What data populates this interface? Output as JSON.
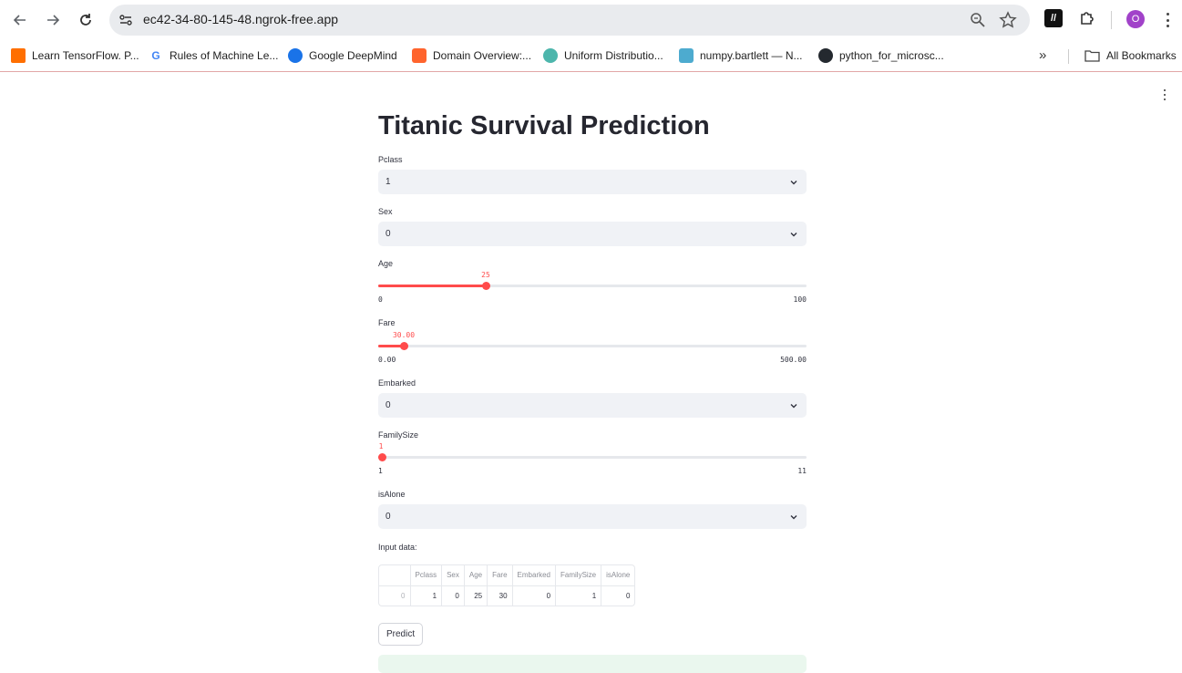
{
  "browser": {
    "url": "ec42-34-80-145-48.ngrok-free.app",
    "profile_initial": "O",
    "bookmarks": [
      {
        "label": "Learn TensorFlow. P...",
        "icon": "tensorflow-icon"
      },
      {
        "label": "Rules of Machine Le...",
        "icon": "google-icon"
      },
      {
        "label": "Google DeepMind",
        "icon": "deepmind-icon"
      },
      {
        "label": "Domain Overview:...",
        "icon": "semrush-icon"
      },
      {
        "label": "Uniform Distributio...",
        "icon": "globe-icon"
      },
      {
        "label": "numpy.bartlett — N...",
        "icon": "numpy-icon"
      },
      {
        "label": "python_for_microsc...",
        "icon": "github-icon"
      }
    ],
    "all_bookmarks_label": "All Bookmarks",
    "ext_label": "//"
  },
  "app": {
    "title": "Titanic Survival Prediction",
    "pclass": {
      "label": "Pclass",
      "value": "1"
    },
    "sex": {
      "label": "Sex",
      "value": "0"
    },
    "age": {
      "label": "Age",
      "value": "25",
      "min": "0",
      "max": "100",
      "fraction": 0.25
    },
    "fare": {
      "label": "Fare",
      "value": "30.00",
      "min": "0.00",
      "max": "500.00",
      "fraction": 0.06
    },
    "embarked": {
      "label": "Embarked",
      "value": "0"
    },
    "familysize": {
      "label": "FamilySize",
      "value": "1",
      "min": "1",
      "max": "11",
      "fraction": 0.0
    },
    "isalone": {
      "label": "isAlone",
      "value": "0"
    },
    "input_label": "Input data:",
    "table": {
      "columns": [
        "",
        "Pclass",
        "Sex",
        "Age",
        "Fare",
        "Embarked",
        "FamilySize",
        "isAlone"
      ],
      "row": [
        "0",
        "1",
        "0",
        "25",
        "30",
        "0",
        "1",
        "0"
      ]
    },
    "predict_label": "Predict"
  },
  "colors": {
    "accent": "#ff4b4b",
    "select_bg": "#f0f2f6",
    "success_bg": "#eaf7ee"
  }
}
